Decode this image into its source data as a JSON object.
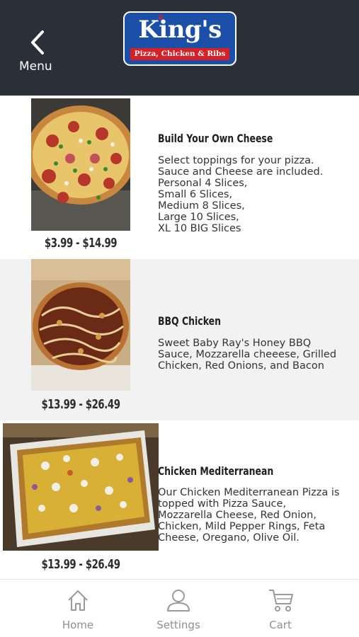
{
  "header": {
    "back_label": "Menu",
    "logo_brand": "King's",
    "logo_tagline": "Pizza, Chicken & Ribs",
    "brand_blue": "#1b4fa8",
    "brand_red": "#d71f26"
  },
  "items": [
    {
      "title": "Build Your Own Cheese",
      "description": "Select toppings for your pizza.\nSauce and Cheese are included.\nPersonal 4 Slices,\nSmall 6 Slices,\nMedium 8 Slices,\nLarge 10 Slices,\nXL 10 BIG Slices",
      "price": "$3.99 - $14.99"
    },
    {
      "title": "BBQ Chicken",
      "description": "Sweet Baby Ray's Honey BBQ\nSauce, Mozzarella cheeese, Grilled\nChicken, Red Onions, and Bacon",
      "price": "$13.99 - $26.49"
    },
    {
      "title": "Chicken Mediterranean",
      "description": "Our Chicken Mediterranean Pizza is\ntopped with Pizza Sauce,\nMozzarella Cheese, Red Onion,\nChicken, Mild Pepper Rings, Feta\nCheese, Oregano, Olive Oil.",
      "price": "$13.99 - $26.49"
    }
  ],
  "tabs": [
    {
      "label": "Home",
      "icon": "home-icon"
    },
    {
      "label": "Settings",
      "icon": "user-icon"
    },
    {
      "label": "Cart",
      "icon": "cart-icon"
    }
  ]
}
